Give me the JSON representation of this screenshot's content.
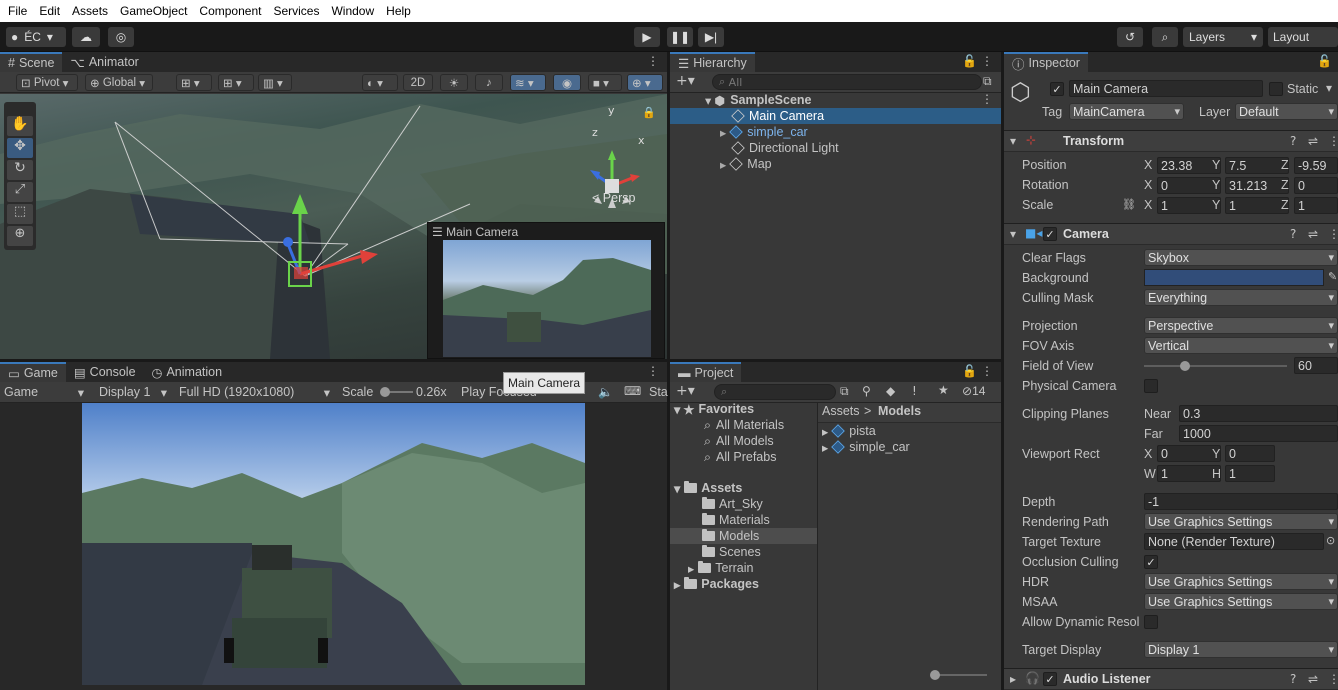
{
  "menu": [
    "File",
    "Edit",
    "Assets",
    "GameObject",
    "Component",
    "Services",
    "Window",
    "Help"
  ],
  "toolbar": {
    "account": "ÉC",
    "layers": "Layers",
    "layout": "Layout"
  },
  "scene": {
    "tabs": [
      "Scene",
      "Animator"
    ],
    "pivot": "Pivot",
    "global": "Global",
    "mode2d": "2D",
    "persp": "Persp",
    "camera_preview_title": "Main Camera"
  },
  "game": {
    "tabs": [
      "Game",
      "Console",
      "Animation"
    ],
    "view": "Game",
    "display": "Display 1",
    "resolution": "Full HD (1920x1080)",
    "scale_label": "Scale",
    "scale_value": "0.26x",
    "play_focused": "Play Focused",
    "stats": "Sta",
    "tooltip": "Main Camera"
  },
  "hierarchy": {
    "title": "Hierarchy",
    "search_placeholder": "All",
    "scene": "SampleScene",
    "items": [
      "Main Camera",
      "simple_car",
      "Directional Light",
      "Map"
    ]
  },
  "project": {
    "title": "Project",
    "hidden_count": "14",
    "favorites": "Favorites",
    "fav_items": [
      "All Materials",
      "All Models",
      "All Prefabs"
    ],
    "assets": "Assets",
    "asset_folders": [
      "Art_Sky",
      "Materials",
      "Models",
      "Scenes",
      "Terrain"
    ],
    "packages": "Packages",
    "breadcrumb_root": "Assets",
    "breadcrumb_sep": ">",
    "breadcrumb_current": "Models",
    "files": [
      "pista",
      "simple_car"
    ]
  },
  "inspector": {
    "title": "Inspector",
    "object_name": "Main Camera",
    "static_label": "Static",
    "tag_label": "Tag",
    "tag_value": "MainCamera",
    "layer_label": "Layer",
    "layer_value": "Default",
    "transform": {
      "title": "Transform",
      "position": {
        "label": "Position",
        "x": "23.38",
        "y": "7.5",
        "z": "-9.59"
      },
      "rotation": {
        "label": "Rotation",
        "x": "0",
        "y": "31.213",
        "z": "0"
      },
      "scale": {
        "label": "Scale",
        "x": "1",
        "y": "1",
        "z": "1"
      }
    },
    "camera": {
      "title": "Camera",
      "clear_flags_label": "Clear Flags",
      "clear_flags": "Skybox",
      "background_label": "Background",
      "background_color": "#314d79",
      "culling_mask_label": "Culling Mask",
      "culling_mask": "Everything",
      "projection_label": "Projection",
      "projection": "Perspective",
      "fov_axis_label": "FOV Axis",
      "fov_axis": "Vertical",
      "fov_label": "Field of View",
      "fov": "60",
      "fov_fraction": 0.29,
      "physical_label": "Physical Camera",
      "clipping_label": "Clipping Planes",
      "near_label": "Near",
      "near": "0.3",
      "far_label": "Far",
      "far": "1000",
      "viewport_label": "Viewport Rect",
      "vx": "0",
      "vy": "0",
      "vw": "1",
      "vh": "1",
      "depth_label": "Depth",
      "depth": "-1",
      "rendering_path_label": "Rendering Path",
      "rendering_path": "Use Graphics Settings",
      "target_texture_label": "Target Texture",
      "target_texture": "None (Render Texture)",
      "occlusion_label": "Occlusion Culling",
      "hdr_label": "HDR",
      "hdr": "Use Graphics Settings",
      "msaa_label": "MSAA",
      "msaa": "Use Graphics Settings",
      "dynres_label": "Allow Dynamic Resol",
      "target_display_label": "Target Display",
      "target_display": "Display 1"
    },
    "audio_listener": "Audio Listener"
  },
  "colors": {
    "accent": "#3a79bb",
    "selection": "#2c5d87"
  }
}
